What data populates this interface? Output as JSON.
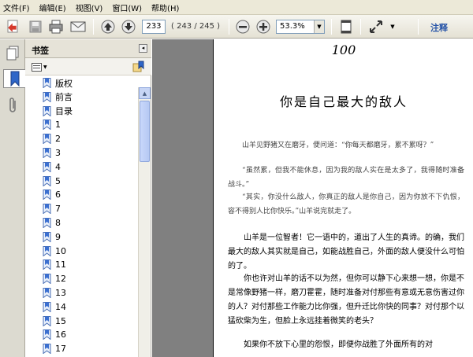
{
  "menu": [
    "文件(F)",
    "编辑(E)",
    "视图(V)",
    "窗口(W)",
    "帮助(H)"
  ],
  "toolbar": {
    "current_page": "233",
    "page_count": "( 243 / 245 )",
    "zoom": "53.3%",
    "annotate_label": "注释"
  },
  "bookmarks": {
    "title": "书签",
    "items": [
      "版权",
      "前言",
      "目录",
      "1",
      "2",
      "3",
      "4",
      "5",
      "6",
      "7",
      "8",
      "9",
      "10",
      "11",
      "12",
      "13",
      "14",
      "15",
      "16",
      "17"
    ]
  },
  "document": {
    "page_number": "100",
    "title": "你是自己最大的敌人",
    "paragraphs": [
      "山羊见野猪又在磨牙，便问道：“你每天都磨牙，累不累呀？”",
      "“虽然累，但我不能休息，因为我的敌人实在是太多了，我得随时准备战斗。”",
      "“其实，你没什么敌人，你真正的敌人是你自己，因为你放不下仇恨，容不得别人比你快乐。”山羊说完就走了。",
      "山羊是一位智者！它一语中的，道出了人生的真谛。的确，我们最大的敌人其实就是自己，如能战胜自己，外面的敌人便没什么可怕的了。",
      "你也许对山羊的话不以为然，但你可以静下心来想一想，你是不是常像野猪一样，磨刀霍霍，随时准备对付那些有意或无意伤害过你的人？对付那些工作能力比你强，但升迁比你快的同事？对付那个以猛砍柴为生，但脸上永远挂着微笑的老头？",
      "如果你不放下心里的怨恨，即便你战胜了外面所有的对"
    ]
  }
}
